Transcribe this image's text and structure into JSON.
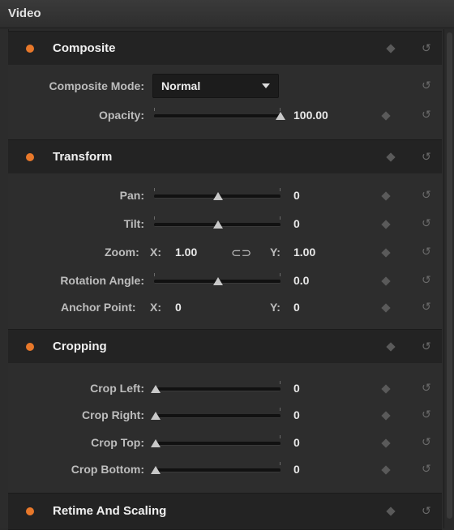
{
  "titlebar": {
    "title": "Video"
  },
  "sections": {
    "composite": {
      "title": "Composite",
      "mode_label": "Composite Mode:",
      "mode_value": "Normal",
      "opacity_label": "Opacity:",
      "opacity_value": "100.00"
    },
    "transform": {
      "title": "Transform",
      "pan_label": "Pan:",
      "pan_value": "0",
      "tilt_label": "Tilt:",
      "tilt_value": "0",
      "zoom_label": "Zoom:",
      "zoom_x_label": "X:",
      "zoom_x_value": "1.00",
      "zoom_y_label": "Y:",
      "zoom_y_value": "1.00",
      "rotation_label": "Rotation Angle:",
      "rotation_value": "0.0",
      "anchor_label": "Anchor Point:",
      "anchor_x_label": "X:",
      "anchor_x_value": "0",
      "anchor_y_label": "Y:",
      "anchor_y_value": "0"
    },
    "cropping": {
      "title": "Cropping",
      "left_label": "Crop Left:",
      "left_value": "0",
      "right_label": "Crop Right:",
      "right_value": "0",
      "top_label": "Crop Top:",
      "top_value": "0",
      "bottom_label": "Crop Bottom:",
      "bottom_value": "0"
    },
    "retime": {
      "title": "Retime And Scaling"
    }
  },
  "icons": {
    "reset": "reset-icon",
    "keyframe": "keyframe-diamond-icon",
    "link": "link-icon",
    "dropdown": "chevron-down-icon"
  },
  "colors": {
    "section_dot": "#e8782a"
  },
  "reset_glyph": "↺",
  "link_glyph": "⊂⊃"
}
